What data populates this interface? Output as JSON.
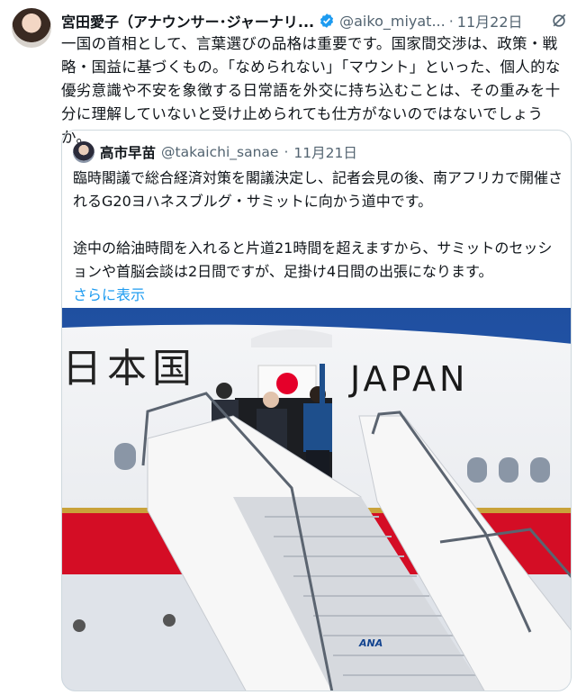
{
  "tweet": {
    "author_name": "宮田愛子（アナウンサー･ジャーナリ...",
    "handle": "@aiko_miyat...",
    "separator": "·",
    "time": "11月22日",
    "text": "一国の首相として、言葉選びの品格は重要です。国家間交渉は、政策・戦略・国益に基づくもの。「なめられない」「マウント」といった、個人的な優劣意識や不安を象徴する日常語を外交に持ち込むことは、その重みを十分に理解していないと受け止められても仕方がないのではないでしょうか。"
  },
  "quote": {
    "author_name": "高市早苗",
    "handle": "@takaichi_sanae",
    "separator": "·",
    "time": "11月21日",
    "paragraph1": "臨時閣議で総合経済対策を閣議決定し、記者会見の後、南アフリカで開催されるG20ヨハネスブルグ・サミットに向かう道中です。",
    "paragraph2": "途中の給油時間を入れると片道21時間を超えますから、サミットのセッションや首脳会談は2日間ですが、足掛け4日間の出張になります。",
    "show_more": "さらに表示",
    "photo": {
      "fuselage_kanji": "日本国",
      "fuselage_latin": "JAPAN",
      "stair_brand": "ANA"
    }
  },
  "colors": {
    "link": "#1d9bf0",
    "verified": "#1d9bf0",
    "muted": "#536471",
    "flag_red": "#e5002a"
  }
}
